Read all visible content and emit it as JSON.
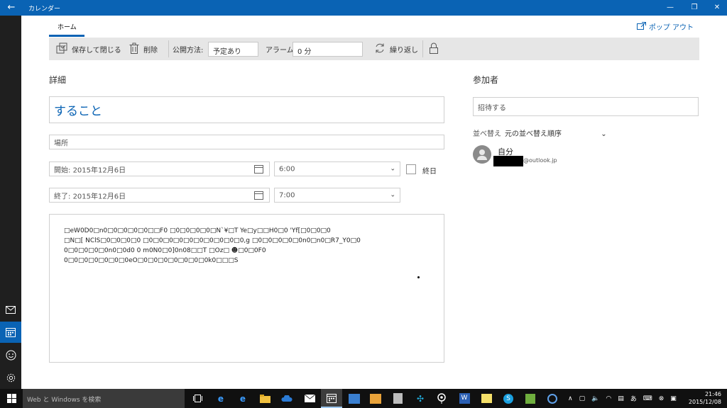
{
  "titlebar": {
    "title": "カレンダー",
    "back": "←",
    "minimize": "—",
    "restore": "❐",
    "close": "✕"
  },
  "tabs": {
    "home": "ホーム",
    "popout": "ポップ アウト"
  },
  "toolbar": {
    "save_close": "保存して閉じる",
    "delete": "削除",
    "show_as_label": "公開方法:",
    "show_as_value": "予定あり",
    "alarm_label": "アラーム:",
    "alarm_value": "0 分",
    "repeat": "繰り返し"
  },
  "details": {
    "title": "詳細",
    "subject": "すること",
    "location_placeholder": "場所",
    "start_label": "開始:",
    "start_date": "2015年12月6日",
    "start_time": "6:00",
    "end_label": "終了:",
    "end_date": "2015年12月6日",
    "end_time": "7:00",
    "all_day": "終日"
  },
  "notes": {
    "lines": [
      "□eW0D0□n0□0□0□0□0□□F0 □0□0□0□0□N`¥□T Ye□y□□H0□0 'Yf[□0□0□0",
      "□N□[ NClS□0□0□0□0 □0□0□0□0□0□0□0□0□0□0,g □0□0□0□0□0n0□n0□R7_Y0□0",
      "0□0□0□0□0n0□0d0 0 m0N0□0]0n08□□T □Oz□ ☻□0□0F0",
      "0□0□0□0□0□0□0eO□0□0□0□0□0□0□0k0□□□S"
    ]
  },
  "attendees": {
    "title": "参加者",
    "invite_placeholder": "招待する",
    "sort_label": "並べ替え",
    "sort_value": "元の並べ替え順序",
    "me_name": "自分",
    "me_email": "@outlook.jp"
  },
  "taskbar": {
    "search_placeholder": "Web と Windows を検索",
    "time": "21:46",
    "date": "2015/12/08"
  },
  "colors": {
    "accent": "#0a63b4",
    "rail": "#1f1f1f",
    "taskbar": "#101010",
    "toolbar": "#e6e6e6"
  }
}
